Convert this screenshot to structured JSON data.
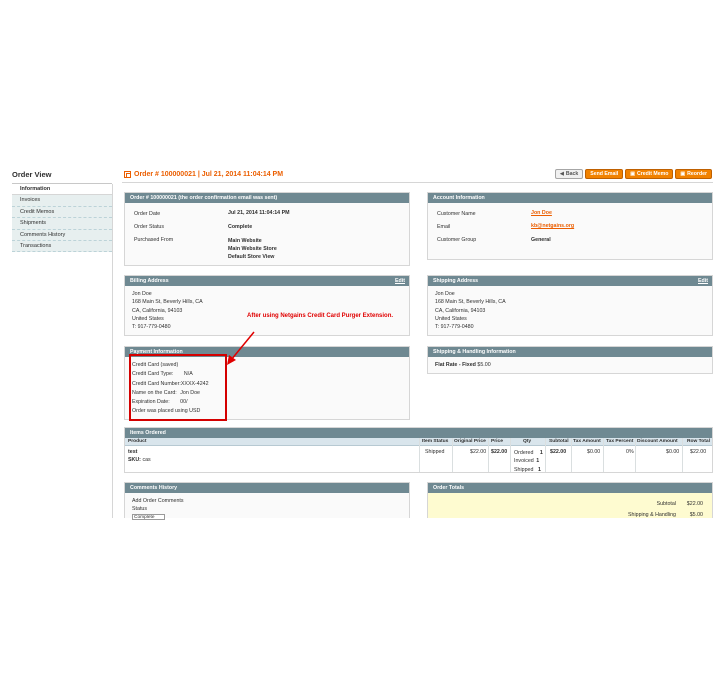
{
  "sidebar": {
    "title": "Order View",
    "items": [
      {
        "label": "Information"
      },
      {
        "label": "Invoices"
      },
      {
        "label": "Credit Memos"
      },
      {
        "label": "Shipments"
      },
      {
        "label": "Comments History"
      },
      {
        "label": "Transactions"
      }
    ]
  },
  "header": {
    "title": "Order # 100000021 | Jul 21, 2014 11:04:14 PM",
    "buttons": {
      "back": "Back",
      "send_email": "Send Email",
      "credit_memo": "Credit Memo",
      "reorder": "Reorder"
    }
  },
  "order_info": {
    "title": "Order # 100000021 (the order confirmation email was sent)",
    "order_date_label": "Order Date",
    "order_date": "Jul 21, 2014 11:04:14 PM",
    "order_status_label": "Order Status",
    "order_status": "Complete",
    "purchased_from_label": "Purchased From",
    "purchased_from": [
      "Main Website",
      "Main Website Store",
      "Default Store View"
    ]
  },
  "account_info": {
    "title": "Account Information",
    "customer_name_label": "Customer Name",
    "customer_name": "Jon Doe",
    "email_label": "Email",
    "email": "kb@netgains.org",
    "customer_group_label": "Customer Group",
    "customer_group": "General"
  },
  "billing": {
    "title": "Billing Address",
    "edit": "Edit",
    "lines": [
      "Jon Doe",
      "168 Main St, Beverly Hills, CA",
      "CA, California, 94103",
      "United States",
      "T: 917-779-0480"
    ]
  },
  "shipping": {
    "title": "Shipping Address",
    "edit": "Edit",
    "lines": [
      "Jon Doe",
      "168 Main St, Beverly Hills, CA",
      "CA, California, 94103",
      "United States",
      "T: 917-779-0480"
    ]
  },
  "annotation": "After using Netgains Credit Card Purger Extension.",
  "payment": {
    "title": "Payment Information",
    "method": "Credit Card (saved)",
    "cc_type_label": "Credit Card Type:",
    "cc_type": "N/A",
    "cc_number_label": "Credit Card Number:",
    "cc_number": "XXXX-4242",
    "name_label": "Name on the Card:",
    "name": "Jon Doe",
    "exp_label": "Expiration Date:",
    "exp": "00/",
    "currency_note": "Order was placed using USD"
  },
  "shipping_method": {
    "title": "Shipping & Handling Information",
    "method": "Flat Rate - Fixed",
    "price": "$5.00"
  },
  "items": {
    "title": "Items Ordered",
    "columns": [
      "Product",
      "Item Status",
      "Original Price",
      "Price",
      "Qty",
      "Subtotal",
      "Tax Amount",
      "Tax Percent",
      "Discount Amount",
      "Row Total"
    ],
    "rows": [
      {
        "product": "test",
        "sku_label": "SKU:",
        "sku": "cas",
        "status": "Shipped",
        "original_price": "$22.00",
        "price": "$22.00",
        "qty": [
          {
            "label": "Ordered",
            "value": "1"
          },
          {
            "label": "Invoiced",
            "value": "1"
          },
          {
            "label": "Shipped",
            "value": "1"
          }
        ],
        "subtotal": "$22.00",
        "tax_amount": "$0.00",
        "tax_percent": "0%",
        "discount": "$0.00",
        "row_total": "$22.00"
      }
    ]
  },
  "comments": {
    "title": "Comments History",
    "add_label": "Add Order Comments",
    "status_label": "Status",
    "status_value": "Complete"
  },
  "totals": {
    "title": "Order Totals",
    "subtotal_label": "Subtotal",
    "subtotal": "$22.00",
    "shipping_label": "Shipping & Handling",
    "shipping": "$5.00"
  },
  "colors": {
    "accent": "#eb5e00",
    "header_bar": "#6f8992",
    "annotation": "#e00000"
  }
}
